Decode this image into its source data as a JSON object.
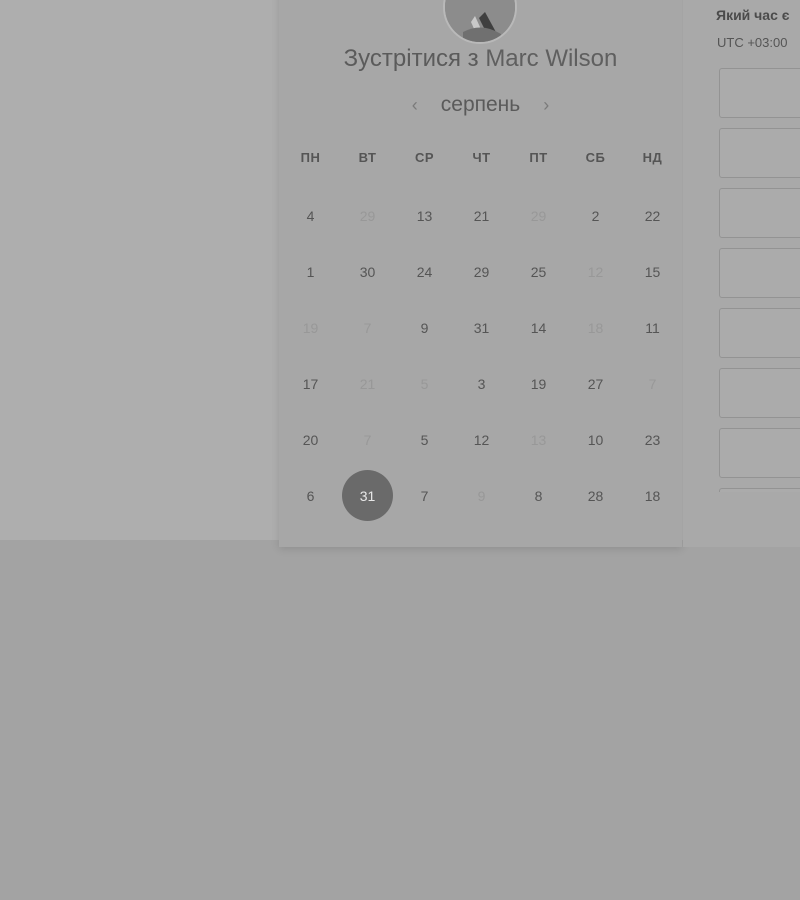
{
  "header": {
    "meet_prefix": "Зустрітися з",
    "host_name": "Marc Wilson"
  },
  "calendar": {
    "month": "серпень",
    "prev_icon": "chevron-left-icon",
    "next_icon": "chevron-right-icon",
    "weekdays": [
      "ПН",
      "ВТ",
      "СР",
      "ЧТ",
      "ПТ",
      "СБ",
      "НД"
    ],
    "weeks": [
      [
        {
          "d": "4"
        },
        {
          "d": "29",
          "muted": true
        },
        {
          "d": "13"
        },
        {
          "d": "21"
        },
        {
          "d": "29",
          "muted": true
        },
        {
          "d": "2"
        },
        {
          "d": "22"
        }
      ],
      [
        {
          "d": "1"
        },
        {
          "d": "30"
        },
        {
          "d": "24"
        },
        {
          "d": "29"
        },
        {
          "d": "25"
        },
        {
          "d": "12",
          "muted": true
        },
        {
          "d": "15"
        }
      ],
      [
        {
          "d": "19",
          "muted": true
        },
        {
          "d": "7",
          "muted": true
        },
        {
          "d": "9"
        },
        {
          "d": "31"
        },
        {
          "d": "14"
        },
        {
          "d": "18",
          "muted": true
        },
        {
          "d": "11"
        }
      ],
      [
        {
          "d": "17"
        },
        {
          "d": "21",
          "muted": true
        },
        {
          "d": "5",
          "muted": true
        },
        {
          "d": "3"
        },
        {
          "d": "19"
        },
        {
          "d": "27"
        },
        {
          "d": "7",
          "muted": true
        }
      ],
      [
        {
          "d": "20"
        },
        {
          "d": "7",
          "muted": true
        },
        {
          "d": "5"
        },
        {
          "d": "12"
        },
        {
          "d": "13",
          "muted": true
        },
        {
          "d": "10"
        },
        {
          "d": "23"
        }
      ],
      [
        {
          "d": "6"
        },
        {
          "d": "31",
          "selected": true
        },
        {
          "d": "7"
        },
        {
          "d": "9",
          "muted": true
        },
        {
          "d": "8"
        },
        {
          "d": "28"
        },
        {
          "d": "18"
        }
      ]
    ]
  },
  "times": {
    "title": "Який час є",
    "timezone": "UTC +03:00",
    "slot_count": 8
  },
  "colors": {
    "overlay": "#a3a3a3",
    "selected_day": "#6a6a6a"
  }
}
